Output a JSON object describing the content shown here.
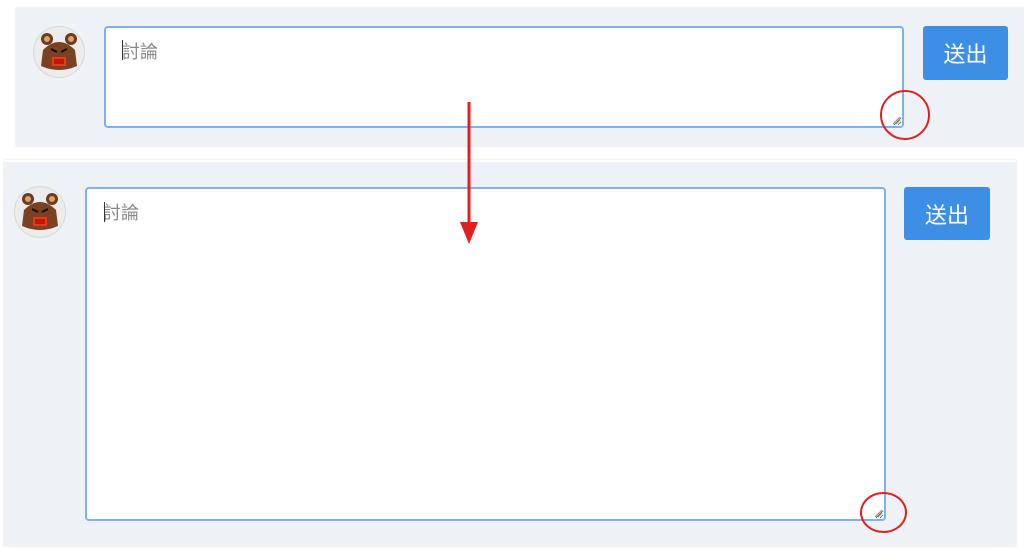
{
  "before": {
    "textarea": {
      "placeholder": "討論",
      "value": ""
    },
    "send_label": "送出"
  },
  "after": {
    "textarea": {
      "placeholder": "討論",
      "value": ""
    },
    "send_label": "送出"
  },
  "colors": {
    "panel_bg": "#eef2f6",
    "textarea_border": "#7fb0ee",
    "button_bg": "#3d8fe6",
    "annotation_red": "#e0201e"
  },
  "icons": {
    "avatar": "bear-avatar-icon",
    "resize_grip": "resize-grip-icon",
    "annotation_arrow": "down-arrow-icon"
  }
}
